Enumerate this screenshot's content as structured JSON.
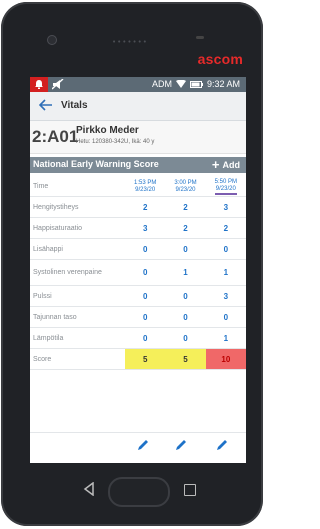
{
  "device": {
    "brand": "ascom",
    "speaker_dots": "•••••••"
  },
  "statusbar": {
    "network": "ADM",
    "time": "9:32 AM"
  },
  "appbar": {
    "title": "Vitals"
  },
  "patient": {
    "bed": "2:A01",
    "name": "Pirkko Meder",
    "info": "Hetu: 120380-342U, Ikä: 40 y"
  },
  "news": {
    "title": "National Early Warning Score",
    "add_label": "Add"
  },
  "table": {
    "time_label": "Time",
    "times": [
      {
        "time": "1:53 PM",
        "date": "9/23/20"
      },
      {
        "time": "3:00 PM",
        "date": "9/23/20"
      },
      {
        "time": "5:50 PM",
        "date": "9/23/20"
      }
    ],
    "rows": [
      {
        "label": "Hengitystiheys",
        "values": [
          "2",
          "2",
          "3"
        ]
      },
      {
        "label": "Happisaturaatio",
        "values": [
          "3",
          "2",
          "2"
        ]
      },
      {
        "label": "Lisähappi",
        "values": [
          "0",
          "0",
          "0"
        ]
      },
      {
        "label": "Systolinen verenpaine",
        "values": [
          "0",
          "1",
          "1"
        ]
      },
      {
        "label": "Pulssi",
        "values": [
          "0",
          "0",
          "3"
        ]
      },
      {
        "label": "Tajunnan taso",
        "values": [
          "0",
          "0",
          "0"
        ]
      },
      {
        "label": "Lämpötila",
        "values": [
          "0",
          "0",
          "1"
        ]
      }
    ],
    "score_label": "Score",
    "scores": [
      "5",
      "5",
      "10"
    ]
  },
  "colors": {
    "accent": "#1e72c8",
    "alarm": "#d32020",
    "score_warning": "#f5ef5a",
    "score_critical": "#f06868",
    "brand": "#e62a2a"
  }
}
